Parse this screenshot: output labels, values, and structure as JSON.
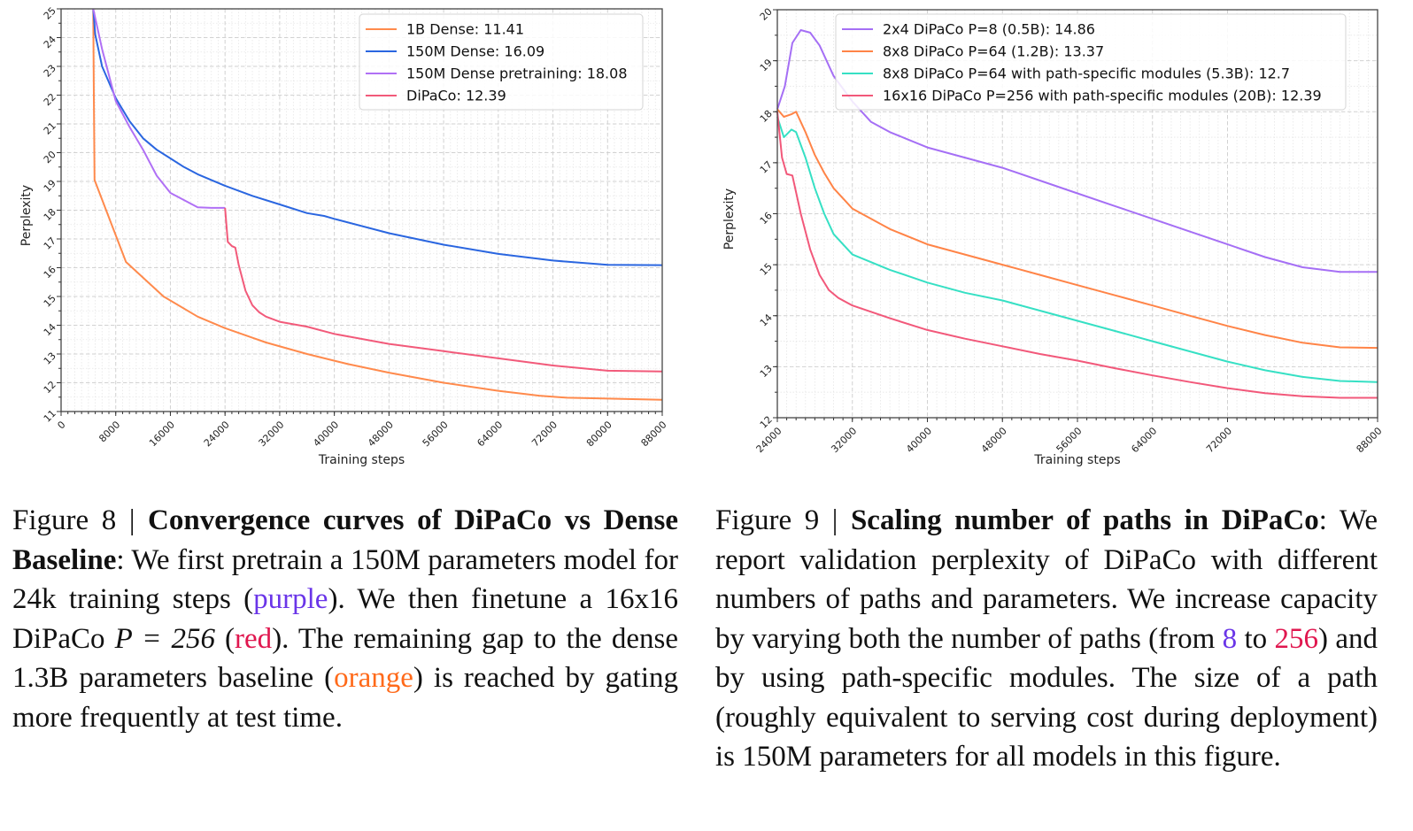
{
  "figure8": {
    "caption": {
      "prefix": "Figure 8 | ",
      "title": "Convergence curves of DiPaCo vs Dense Baseline",
      "part1": ": We first pretrain a 150M parameters model for 24k training steps (",
      "purple_word": "purple",
      "part2": "). We then finetune a 16x16 DiPaCo ",
      "math": "P = 256",
      "part3": " (",
      "red_word": "red",
      "part4": "). The remaining gap to the dense 1.3B parameters baseline (",
      "orange_word": "orange",
      "part5": ") is reached by gating more frequently at test time."
    }
  },
  "figure9": {
    "caption": {
      "prefix": "Figure 9 | ",
      "title": "Scaling number of paths in DiPaCo",
      "part1": ": We report validation perplexity of DiPaCo with different numbers of paths and parameters. We increase capacity by varying both the number of paths (from ",
      "purple_num": "8",
      "part2": " to ",
      "red_num": "256",
      "part3": ") and by using path-specific modules. The size of a path (roughly equivalent to serving cost during deployment) is 150M parameters for all models in this figure."
    }
  },
  "chart_data": [
    {
      "type": "line",
      "title": "",
      "xlabel": "Training steps",
      "ylabel": "Perplexity",
      "xlim": [
        0,
        88000
      ],
      "ylim": [
        11,
        25
      ],
      "xticks": [
        0,
        8000,
        16000,
        24000,
        32000,
        40000,
        48000,
        56000,
        64000,
        72000,
        80000,
        88000
      ],
      "yticks": [
        11,
        12,
        13,
        14,
        15,
        16,
        17,
        18,
        19,
        20,
        21,
        22,
        23,
        24,
        25
      ],
      "grid": true,
      "legend_position": "top-right",
      "series": [
        {
          "name": "1B Dense: 11.41",
          "color": "#ff8a4c",
          "x": [
            4700,
            4800,
            4900,
            9500,
            15000,
            20000,
            24000,
            30000,
            36000,
            42000,
            48000,
            56000,
            64000,
            70000,
            74000,
            80000,
            88000
          ],
          "y": [
            25,
            22,
            19.05,
            16.2,
            15.0,
            14.3,
            13.9,
            13.4,
            13.0,
            12.65,
            12.35,
            12.0,
            11.72,
            11.55,
            11.48,
            11.45,
            11.41
          ]
        },
        {
          "name": "150M Dense: 16.09",
          "color": "#2a66e0",
          "x": [
            4700,
            5000,
            6000,
            8000,
            10000,
            12000,
            14000,
            16000,
            18000,
            20000,
            24000,
            28000,
            32000,
            36000,
            38500,
            40000,
            48000,
            56000,
            64000,
            72000,
            80000,
            88000
          ],
          "y": [
            25,
            24.1,
            23.0,
            21.9,
            21.1,
            20.5,
            20.1,
            19.8,
            19.5,
            19.25,
            18.85,
            18.5,
            18.2,
            17.9,
            17.8,
            17.7,
            17.2,
            16.8,
            16.48,
            16.25,
            16.1,
            16.09
          ]
        },
        {
          "name": "150M Dense pretraining: 18.08",
          "color": "#b070f5",
          "x": [
            4700,
            6000,
            8000,
            10000,
            12000,
            14000,
            16000,
            18000,
            20000,
            22000,
            24000
          ],
          "y": [
            25,
            23.6,
            21.8,
            20.9,
            20.1,
            19.2,
            18.6,
            18.35,
            18.1,
            18.08,
            18.08
          ]
        },
        {
          "name": "DiPaCo: 12.39",
          "color": "#f25a7a",
          "x": [
            24000,
            24400,
            25000,
            25500,
            26000,
            27000,
            28000,
            29000,
            30000,
            32000,
            36000,
            40000,
            48000,
            56000,
            64000,
            72000,
            80000,
            88000
          ],
          "y": [
            18.08,
            16.9,
            16.75,
            16.7,
            16.1,
            15.2,
            14.7,
            14.45,
            14.3,
            14.12,
            13.95,
            13.7,
            13.35,
            13.1,
            12.85,
            12.6,
            12.42,
            12.39
          ]
        }
      ]
    },
    {
      "type": "line",
      "title": "",
      "xlabel": "Training steps",
      "ylabel": "Perplexity",
      "xlim": [
        24000,
        88000
      ],
      "ylim": [
        12,
        20
      ],
      "xticks": [
        24000,
        32000,
        40000,
        48000,
        56000,
        64000,
        72000,
        88000
      ],
      "yticks": [
        12,
        13,
        14,
        15,
        16,
        17,
        18,
        19,
        20
      ],
      "grid": true,
      "legend_position": "top-right",
      "series": [
        {
          "name": "2x4 DiPaCo P=8 (0.5B): 14.86",
          "color": "#a56ff5",
          "x": [
            24000,
            24800,
            25600,
            26500,
            27500,
            28500,
            30000,
            32000,
            34000,
            36000,
            38000,
            40000,
            42000,
            44000,
            48000,
            52000,
            56000,
            60000,
            64000,
            68000,
            72000,
            76000,
            80000,
            84000,
            88000
          ],
          "y": [
            18.05,
            18.5,
            19.35,
            19.6,
            19.55,
            19.3,
            18.7,
            18.2,
            17.8,
            17.6,
            17.45,
            17.3,
            17.2,
            17.1,
            16.9,
            16.65,
            16.4,
            16.15,
            15.9,
            15.65,
            15.4,
            15.15,
            14.95,
            14.86,
            14.86
          ]
        },
        {
          "name": "8x8 DiPaCo P=64 (1.2B): 13.37",
          "color": "#ff8447",
          "x": [
            24000,
            24700,
            25500,
            26000,
            27000,
            28000,
            29000,
            30000,
            32000,
            36000,
            40000,
            44000,
            48000,
            52000,
            56000,
            60000,
            64000,
            68000,
            72000,
            76000,
            80000,
            84000,
            88000
          ],
          "y": [
            18.05,
            17.9,
            17.95,
            18.0,
            17.6,
            17.15,
            16.8,
            16.5,
            16.1,
            15.7,
            15.4,
            15.2,
            15.0,
            14.8,
            14.6,
            14.4,
            14.2,
            14.0,
            13.8,
            13.62,
            13.47,
            13.38,
            13.37
          ]
        },
        {
          "name": "8x8 DiPaCo P=64 with path-specific modules (5.3B): 12.7",
          "color": "#36e0c4",
          "x": [
            24000,
            24700,
            25500,
            26000,
            27000,
            28000,
            29000,
            30000,
            32000,
            36000,
            40000,
            44000,
            48000,
            52000,
            56000,
            60000,
            64000,
            68000,
            72000,
            76000,
            80000,
            84000,
            88000
          ],
          "y": [
            17.9,
            17.5,
            17.65,
            17.6,
            17.1,
            16.5,
            16.0,
            15.6,
            15.2,
            14.9,
            14.65,
            14.45,
            14.3,
            14.1,
            13.9,
            13.7,
            13.5,
            13.3,
            13.1,
            12.93,
            12.8,
            12.72,
            12.7
          ]
        },
        {
          "name": "16x16 DiPaCo P=256 with path-specific modules (20B): 12.39",
          "color": "#f2587a",
          "x": [
            24000,
            24500,
            25000,
            25600,
            26500,
            27500,
            28500,
            29500,
            30500,
            32000,
            36000,
            40000,
            44000,
            48000,
            52000,
            56000,
            60000,
            64000,
            68000,
            72000,
            76000,
            80000,
            84000,
            88000
          ],
          "y": [
            18.0,
            17.1,
            16.78,
            16.75,
            16.0,
            15.3,
            14.8,
            14.5,
            14.35,
            14.2,
            13.95,
            13.72,
            13.55,
            13.4,
            13.25,
            13.12,
            12.97,
            12.83,
            12.7,
            12.58,
            12.48,
            12.42,
            12.39,
            12.39
          ]
        }
      ]
    }
  ]
}
